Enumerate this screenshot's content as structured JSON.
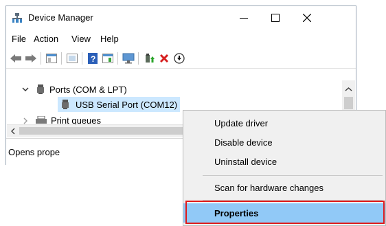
{
  "window": {
    "title": "Device Manager",
    "controls": {
      "minimize": "—",
      "maximize": "☐",
      "close": "✕"
    }
  },
  "menubar": {
    "items": [
      "File",
      "Action",
      "View",
      "Help"
    ]
  },
  "tree": {
    "items": [
      {
        "label": "Ports (COM & LPT)",
        "expanded": true
      },
      {
        "label": "USB Serial Port (COM12)",
        "selected": true
      },
      {
        "label": "Print queues",
        "expanded": false
      }
    ]
  },
  "statusbar": {
    "text": "Opens prope"
  },
  "context_menu": {
    "items": [
      {
        "label": "Update driver"
      },
      {
        "label": "Disable device"
      },
      {
        "label": "Uninstall device"
      },
      {
        "label": "Scan for hardware changes"
      },
      {
        "label": "Properties",
        "highlighted": true
      }
    ]
  },
  "colors": {
    "selection": "#cce8ff",
    "menu_highlight": "#91c9f7",
    "callout": "#e01b1b",
    "delete_red": "#d61f1f"
  }
}
